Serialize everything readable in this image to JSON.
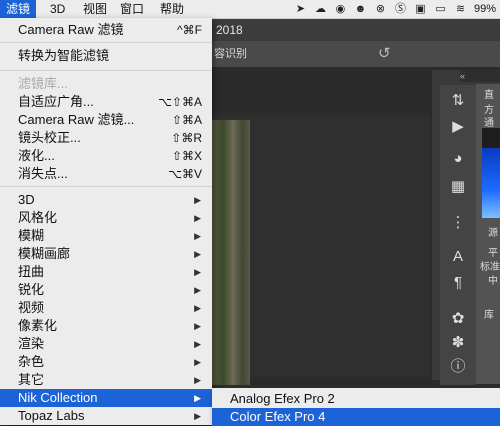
{
  "menubar": {
    "items": [
      "滤镜",
      "3D",
      "视图",
      "窗口",
      "帮助"
    ],
    "battery": "99%",
    "status_icons": [
      "location-icon",
      "creative-cloud-icon",
      "game-controller-icon",
      "owl-icon",
      "close-circle-icon",
      "s-icon",
      "layers-icon",
      "airplay-icon",
      "wifi-icon"
    ]
  },
  "photoshop": {
    "title_year": "2018",
    "options_text": "容识别"
  },
  "filter_menu": {
    "top": [
      {
        "label": "Camera Raw 滤镜",
        "shortcut": "^⌘F"
      },
      {
        "label": "转换为智能滤镜",
        "shortcut": ""
      }
    ],
    "group2": [
      {
        "label": "滤镜库...",
        "shortcut": "",
        "disabled": true
      },
      {
        "label": "自适应广角...",
        "shortcut": "⌥⇧⌘A"
      },
      {
        "label": "Camera Raw 滤镜...",
        "shortcut": "⇧⌘A"
      },
      {
        "label": "镜头校正...",
        "shortcut": "⇧⌘R"
      },
      {
        "label": "液化...",
        "shortcut": "⇧⌘X"
      },
      {
        "label": "消失点...",
        "shortcut": "⌥⌘V"
      }
    ],
    "submenus": [
      "3D",
      "风格化",
      "模糊",
      "模糊画廊",
      "扭曲",
      "锐化",
      "视频",
      "像素化",
      "渲染",
      "杂色",
      "其它"
    ],
    "plugins": [
      "Nik Collection",
      "Topaz Labs"
    ]
  },
  "nik_submenu": {
    "items": [
      "Analog Efex Pro 2",
      "Color Efex Pro 4"
    ]
  },
  "right_panel": {
    "labels": [
      "直方",
      "通道",
      "源",
      "平",
      "标准",
      "中",
      "库"
    ]
  },
  "colors": {
    "highlight": "#1b63d6",
    "menu_bg": "#ececec",
    "ps_dark": "#2b2b2b"
  }
}
